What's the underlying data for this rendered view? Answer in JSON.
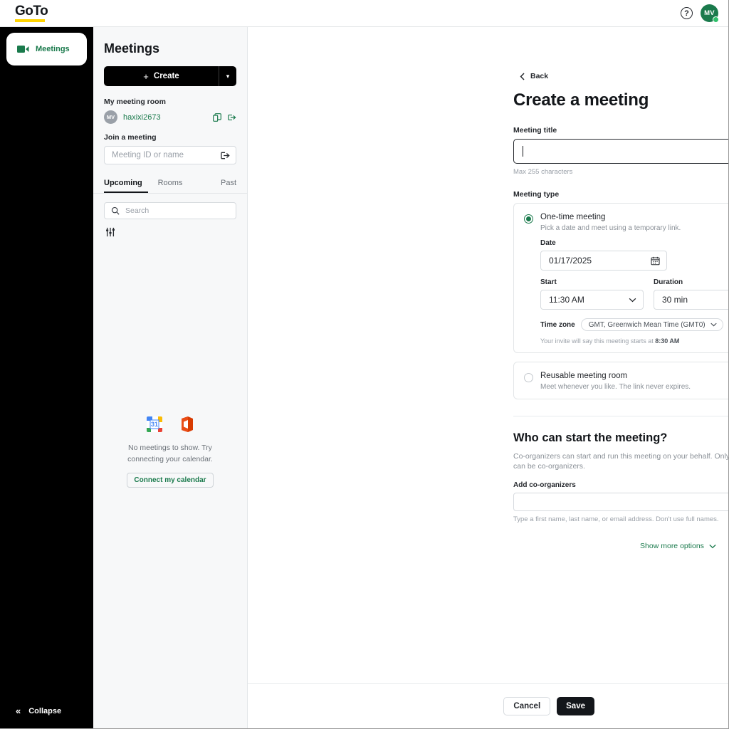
{
  "topbar": {
    "brand": "GoTo",
    "help_icon": "question-mark-icon",
    "avatar_initials": "MV"
  },
  "rail": {
    "items": [
      {
        "label": "Meetings",
        "icon": "video-camera-icon",
        "active": true
      }
    ],
    "collapse_label": "Collapse",
    "collapse_icon": "double-chevron-left-icon"
  },
  "panel": {
    "title": "Meetings",
    "create_label": "Create",
    "create_caret_icon": "chevron-down-icon",
    "my_room_label": "My meeting room",
    "room_avatar_initials": "MV",
    "room_name": "haxixi2673",
    "copy_icon": "copy-icon",
    "room_join_icon": "enter-arrow-icon",
    "join_label": "Join a meeting",
    "join_placeholder": "Meeting ID or name",
    "join_icon": "enter-arrow-icon",
    "tabs": [
      {
        "label": "Upcoming",
        "active": true
      },
      {
        "label": "Rooms",
        "active": false
      },
      {
        "label": "Past",
        "active": false
      }
    ],
    "search_placeholder": "Search",
    "search_icon": "search-icon",
    "filter_icon": "sliders-filter-icon",
    "empty_line1": "No meetings to show. Try",
    "empty_line2": "connecting your calendar.",
    "connect_label": "Connect my calendar",
    "calendar_badges": [
      "google-calendar-icon",
      "microsoft-office-icon"
    ]
  },
  "main": {
    "back_label": "Back",
    "back_icon": "chevron-left-icon",
    "page_title": "Create a meeting",
    "meeting_title_label": "Meeting title",
    "meeting_title_value": "",
    "meeting_title_hint": "Max 255 characters",
    "meeting_type_label": "Meeting type",
    "options": [
      {
        "title": "One-time meeting",
        "desc": "Pick a date and meet using a temporary link.",
        "selected": true,
        "icon": "calendar-days-icon"
      },
      {
        "title": "Reusable meeting room",
        "desc": "Meet whenever you like. The link never expires.",
        "selected": false,
        "icon": "calendar-repeat-icon"
      }
    ],
    "date_label": "Date",
    "date_value": "01/17/2025",
    "date_icon": "calendar-icon",
    "start_label": "Start",
    "start_value": "11:30 AM",
    "duration_label": "Duration",
    "duration_value": "30 min",
    "timezone_label": "Time zone",
    "timezone_value": "GMT, Greenwich Mean Time (GMT0)",
    "invite_note_prefix": "Your invite will say this meeting starts at ",
    "invite_note_time": "8:30 AM",
    "who_heading": "Who can start the meeting?",
    "who_desc": "Co-organizers can start and run this meeting on your behalf. Only members of your account can be co-organizers.",
    "co_label": "Add co-organizers",
    "co_value": "",
    "co_hint": "Type a first name, last name, or email address. Don't use full names.",
    "more_options_label": "Show more options",
    "more_options_icon": "chevron-down-icon"
  },
  "footer": {
    "cancel_label": "Cancel",
    "save_label": "Save"
  },
  "colors": {
    "brand_green": "#1a7a4c",
    "brand_yellow": "#ffd400",
    "black": "#000000"
  }
}
